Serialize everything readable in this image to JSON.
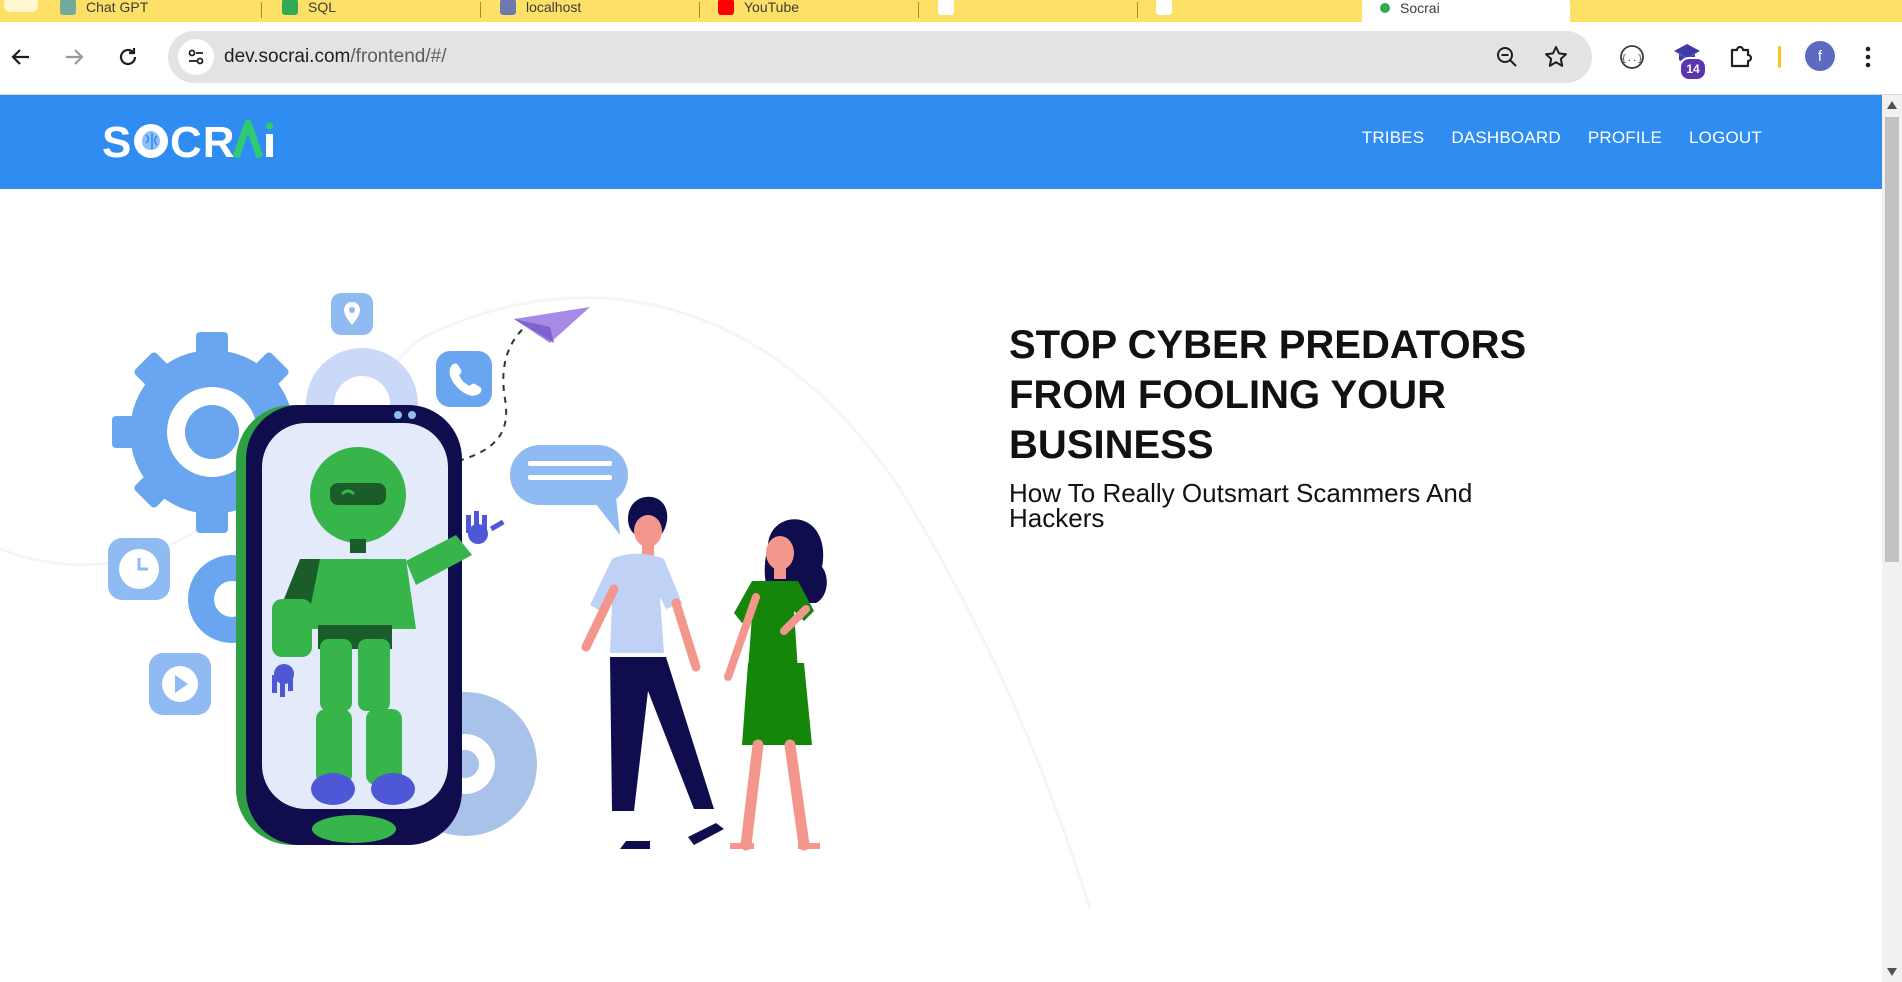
{
  "browser": {
    "tabs": [
      {
        "label": "Chat GPT",
        "color": "#74aa9c"
      },
      {
        "label": "SQL",
        "color": "#34a853"
      },
      {
        "label": "localhost",
        "color": "#6c78af"
      },
      {
        "label": "YouTube",
        "color": "#ff0000"
      },
      {
        "label": "",
        "color": "#ffffff"
      },
      {
        "label": "",
        "color": "#ffffff"
      }
    ],
    "active_tab": {
      "label": "Socrai"
    },
    "url_domain": "dev.socrai.com",
    "url_path": "/frontend/#/",
    "extension_badge": "14",
    "profile_initial": "f",
    "accent_color": "#fde066"
  },
  "site": {
    "logo_text": "SOCRAI",
    "nav": [
      "TRIBES",
      "DASHBOARD",
      "PROFILE",
      "LOGOUT"
    ],
    "brand_color": "#2f8cf0"
  },
  "hero": {
    "title": "STOP CYBER PREDATORS FROM FOOLING YOUR BUSINESS",
    "subtitle": "How To Really Outsmart Scammers And Hackers"
  }
}
